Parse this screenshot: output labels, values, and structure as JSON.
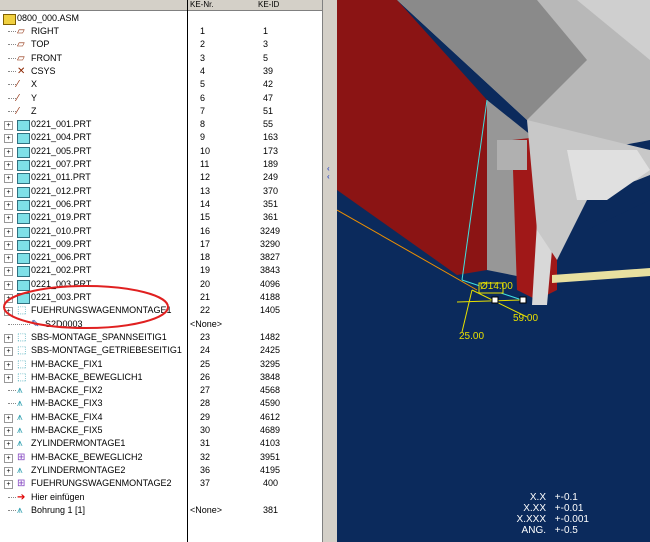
{
  "tree": {
    "columns": {
      "name": "",
      "nr": "KE-Nr.",
      "id": "KE-ID"
    },
    "root": "0800_000.ASM",
    "rows": [
      {
        "label": "RIGHT",
        "nr": "1",
        "id": "1",
        "icon": "datum-plane",
        "expand": false
      },
      {
        "label": "TOP",
        "nr": "2",
        "id": "3",
        "icon": "datum-plane",
        "expand": false
      },
      {
        "label": "FRONT",
        "nr": "3",
        "id": "5",
        "icon": "datum-plane",
        "expand": false
      },
      {
        "label": "CSYS",
        "nr": "4",
        "id": "39",
        "icon": "csys",
        "expand": false
      },
      {
        "label": "X",
        "nr": "5",
        "id": "42",
        "icon": "axis",
        "expand": false
      },
      {
        "label": "Y",
        "nr": "6",
        "id": "47",
        "icon": "axis",
        "expand": false
      },
      {
        "label": "Z",
        "nr": "7",
        "id": "51",
        "icon": "axis",
        "expand": false
      },
      {
        "label": "0221_001.PRT",
        "nr": "8",
        "id": "55",
        "icon": "part",
        "expand": true
      },
      {
        "label": "0221_004.PRT",
        "nr": "9",
        "id": "163",
        "icon": "part",
        "expand": true
      },
      {
        "label": "0221_005.PRT",
        "nr": "10",
        "id": "173",
        "icon": "part",
        "expand": true
      },
      {
        "label": "0221_007.PRT",
        "nr": "11",
        "id": "189",
        "icon": "part",
        "expand": true
      },
      {
        "label": "0221_011.PRT",
        "nr": "12",
        "id": "249",
        "icon": "part",
        "expand": true
      },
      {
        "label": "0221_012.PRT",
        "nr": "13",
        "id": "370",
        "icon": "part",
        "expand": true
      },
      {
        "label": "0221_006.PRT",
        "nr": "14",
        "id": "351",
        "icon": "part",
        "expand": true
      },
      {
        "label": "0221_019.PRT",
        "nr": "15",
        "id": "361",
        "icon": "part",
        "expand": true
      },
      {
        "label": "0221_010.PRT",
        "nr": "16",
        "id": "3249",
        "icon": "part",
        "expand": true
      },
      {
        "label": "0221_009.PRT",
        "nr": "17",
        "id": "3290",
        "icon": "part",
        "expand": true
      },
      {
        "label": "0221_006.PRT",
        "nr": "18",
        "id": "3827",
        "icon": "part",
        "expand": true
      },
      {
        "label": "0221_002.PRT",
        "nr": "19",
        "id": "3843",
        "icon": "part",
        "expand": true
      },
      {
        "label": "0221_003.PRT",
        "nr": "20",
        "id": "4096",
        "icon": "part",
        "expand": true
      },
      {
        "label": "0221_003.PRT",
        "nr": "21",
        "id": "4188",
        "icon": "part",
        "expand": true
      },
      {
        "label": "FUEHRUNGSWAGENMONTAGE1",
        "nr": "22",
        "id": "1405",
        "icon": "subasm",
        "expand": true
      },
      {
        "label": "S2D0003",
        "nr": "<None>",
        "id": "",
        "icon": "drawing",
        "expand": false,
        "indent": true
      },
      {
        "label": "SBS-MONTAGE_SPANNSEITIG1",
        "nr": "23",
        "id": "1482",
        "icon": "subasm",
        "expand": true
      },
      {
        "label": "SBS-MONTAGE_GETRIEBESEITIG1",
        "nr": "24",
        "id": "2425",
        "icon": "subasm",
        "expand": true
      },
      {
        "label": "HM-BACKE_FIX1",
        "nr": "25",
        "id": "3295",
        "icon": "subasm",
        "expand": true
      },
      {
        "label": "HM-BACKE_BEWEGLICH1",
        "nr": "26",
        "id": "3848",
        "icon": "subasm",
        "expand": true
      },
      {
        "label": "HM-BACKE_FIX2",
        "nr": "27",
        "id": "4568",
        "icon": "pattern",
        "expand": false
      },
      {
        "label": "HM-BACKE_FIX3",
        "nr": "28",
        "id": "4590",
        "icon": "pattern",
        "expand": false
      },
      {
        "label": "HM-BACKE_FIX4",
        "nr": "29",
        "id": "4612",
        "icon": "pattern",
        "expand": true
      },
      {
        "label": "HM-BACKE_FIX5",
        "nr": "30",
        "id": "4689",
        "icon": "pattern",
        "expand": true
      },
      {
        "label": "ZYLINDERMONTAGE1",
        "nr": "31",
        "id": "4103",
        "icon": "pattern",
        "expand": true
      },
      {
        "label": "HM-BACKE_BEWEGLICH2",
        "nr": "32",
        "id": "3951",
        "icon": "group",
        "expand": true
      },
      {
        "label": "ZYLINDERMONTAGE2",
        "nr": "36",
        "id": "4195",
        "icon": "pattern",
        "expand": true
      },
      {
        "label": "FUEHRUNGSWAGENMONTAGE2",
        "nr": "37",
        "id": "400",
        "icon": "group",
        "expand": true
      },
      {
        "label": "Hier einfügen",
        "nr": "",
        "id": "",
        "icon": "insert-arrow",
        "expand": false
      },
      {
        "label": "Bohrung 1 [1]",
        "nr": "<None>",
        "id": "381",
        "icon": "pattern",
        "expand": false
      }
    ]
  },
  "viewport": {
    "dimensions": [
      "Ø14.00",
      "59.00",
      "25.00"
    ],
    "tolerances": [
      {
        "fmt": "X.X",
        "val": "+-0.1"
      },
      {
        "fmt": "X.XX",
        "val": "+-0.01"
      },
      {
        "fmt": "X.XXX",
        "val": "+-0.001"
      },
      {
        "fmt": "ANG.",
        "val": "+-0.5"
      }
    ]
  },
  "colors": {
    "background": "#0b2a5c",
    "highlight": "#e02020",
    "dimension": "#e8e000"
  }
}
